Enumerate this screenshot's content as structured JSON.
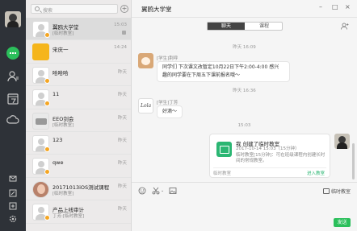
{
  "colors": {
    "accent": "#2bbf5b",
    "rail": "#2e3238",
    "badge": "#f5a623"
  },
  "search": {
    "placeholder": "搜索"
  },
  "conversations": [
    {
      "name": "翼鸥大学堂",
      "sub": "[临时教室]",
      "time": "15:03",
      "avatar": "generic",
      "active": true,
      "muted": true
    },
    {
      "name": "宋庆一",
      "sub": "",
      "time": "14:24",
      "avatar": "yellow"
    },
    {
      "name": "哈哈哈",
      "sub": "",
      "time": "昨天",
      "avatar": "generic"
    },
    {
      "name": "11",
      "sub": "",
      "time": "昨天",
      "avatar": "generic"
    },
    {
      "name": "EEO剑会",
      "sub": "[临时教室]",
      "time": "昨天",
      "avatar": "eeo"
    },
    {
      "name": "123",
      "sub": "",
      "time": "昨天",
      "avatar": "generic"
    },
    {
      "name": "qwe",
      "sub": "",
      "time": "昨天",
      "avatar": "generic"
    },
    {
      "name": "20171013iOS测试课程",
      "sub": "[临时教室]",
      "time": "昨天",
      "avatar": "photo"
    },
    {
      "name": "产品上线审计",
      "sub": "丁芳:[临时教室]",
      "time": "昨天",
      "avatar": "generic"
    }
  ],
  "chat": {
    "title": "翼鸥大学堂",
    "tabs": [
      "聊天",
      "课程"
    ],
    "time1": "昨天 16:09",
    "msg1_sender": "[学生]荆呼",
    "msg1_line1": "同学们 下次课文改暂定10月22日下午2:00-4:00 感兴",
    "msg1_line2": "趣的同学要在下周五下课前报名哦～",
    "time2": "昨天 16:36",
    "msg2_sender": "[学生]丁芳",
    "msg2_text": "好滴～",
    "time3": "15:03",
    "sig_text": "Lola",
    "card": {
      "title": "我 创建了临时教室",
      "line1": "2017-10-14 15:03（15分钟）",
      "line2": "临时教室[15分钟]：可在班级课程内创建长时间的常规教室。",
      "footer": "临时教室",
      "link": "进入教室"
    },
    "record_label": "临时教室",
    "send_label": "发送"
  }
}
